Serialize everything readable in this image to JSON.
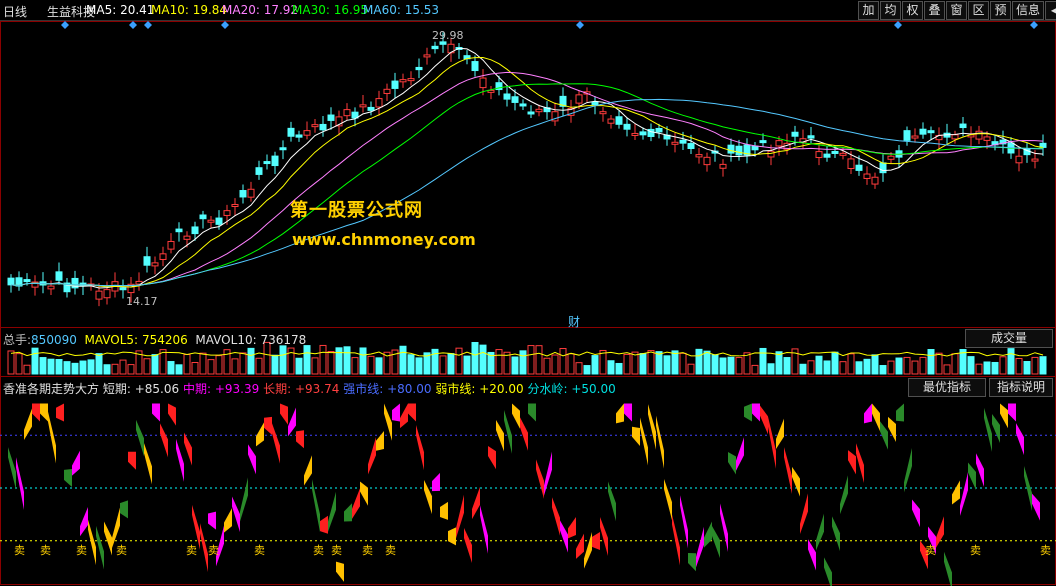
{
  "header": {
    "period": "日线",
    "stock": "生益科技",
    "ma5_label": "MA5:",
    "ma5": "20.41",
    "ma10_label": "MA10:",
    "ma10": "19.84",
    "ma20_label": "MA20:",
    "ma20": "17.92",
    "ma30_label": "MA30:",
    "ma30": "16.95",
    "ma60_label": "MA60:",
    "ma60": "15.53",
    "toolbar": [
      "加",
      "均",
      "权",
      "叠",
      "窗",
      "区",
      "预",
      "信息",
      "◀",
      "▶"
    ]
  },
  "price": {
    "high_label": "29.98",
    "low_label": "14.17",
    "fin_marker": "财"
  },
  "watermark": {
    "line1": "第一股票公式网",
    "line2": "www.chnmoney.com"
  },
  "volume": {
    "label": "总手:",
    "value": "850090",
    "mavol5_label": "MAVOL5:",
    "mavol5": "754206",
    "mavol10_label": "MAVOL10:",
    "mavol10": "736178",
    "button": "成交量"
  },
  "indicator": {
    "name": "香准各期走势大方",
    "short_label": "短期:",
    "short": "+85.06",
    "mid_label": "中期:",
    "mid": "+93.39",
    "long_label": "长期:",
    "long": "+93.74",
    "strong_label": "强市线:",
    "strong": "+80.00",
    "weak_label": "弱市线:",
    "weak": "+20.00",
    "water_label": "分水岭:",
    "water": "+50.00",
    "btn_opt": "最优指标",
    "btn_help": "指标说明",
    "sell_mark": "卖"
  },
  "colors": {
    "up": "#ff3c3c",
    "down": "#54ffff",
    "ma5": "#ffffff",
    "ma10": "#ffff00",
    "ma20": "#ff80ff",
    "ma30": "#00ff00",
    "ma60": "#54c8ff",
    "short": "#ff2020",
    "mid": "#ff00ff",
    "long": "#ff4040",
    "strong": "#4040ff",
    "weak": "#ffff00",
    "water": "#00ffff"
  }
}
